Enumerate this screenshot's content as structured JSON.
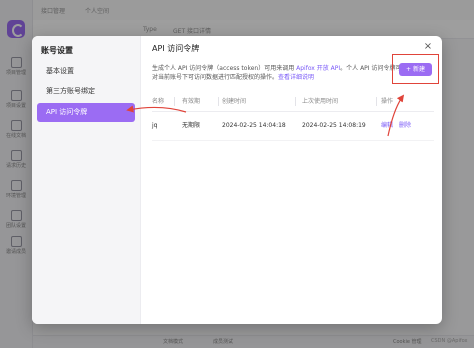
{
  "app": {
    "sidebar_items": [
      "项目管理",
      "项目设置",
      "在线文档",
      "请求历史",
      "环境管理",
      "团队设置",
      "邀请成员"
    ],
    "top_text": [
      "接口管理",
      "个人空间"
    ],
    "tab_text": [
      "Type",
      "GET 接口详情"
    ],
    "status_items": [
      "文档模式",
      "成员测试",
      "Cookie 管理"
    ],
    "watermark": "CSDN @Apifox"
  },
  "modal": {
    "nav_title": "账号设置",
    "nav_items": [
      {
        "label": "基本设置",
        "active": false
      },
      {
        "label": "第三方账号绑定",
        "active": false
      },
      {
        "label": "API 访问令牌",
        "active": true
      }
    ],
    "title": "API 访问令牌",
    "close_label": "×",
    "description_text": "生成个人 API 访问令牌（access token）可用来调用 ",
    "description_link": "Apifox 开放 API",
    "description_text2": "。个人 API 访问令牌可对当前账号下可访问数据进行匹配授权的操作。",
    "description_link2": "查看详细说明",
    "new_button": "+ 新建",
    "table": {
      "headers": [
        "名称",
        "有效期",
        "创建时间",
        "上次使用时间",
        "操作"
      ],
      "rows": [
        {
          "name": "jq",
          "validity": "无期限",
          "created": "2024-02-25 14:04:18",
          "last_used": "2024-02-25 14:08:19",
          "edit": "编辑",
          "delete": "删除"
        }
      ]
    }
  },
  "colors": {
    "accent": "#9b6cf3",
    "annotation": "#e0443a"
  }
}
